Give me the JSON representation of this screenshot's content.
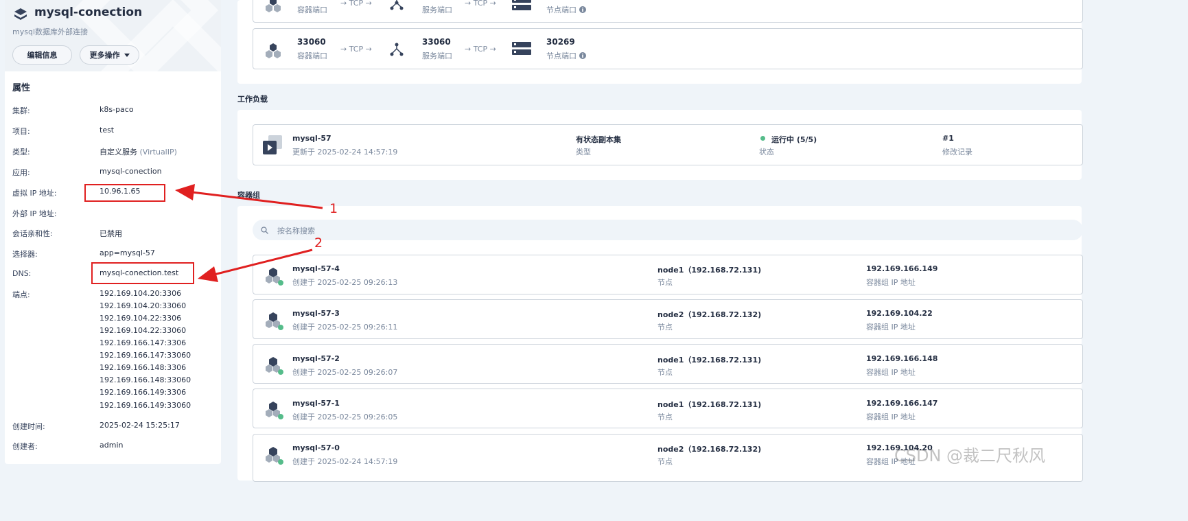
{
  "header": {
    "title": "mysql-conection",
    "description": "mysql数据库外部连接",
    "edit_button": "编辑信息",
    "more_button": "更多操作"
  },
  "properties": {
    "heading": "属性",
    "items": [
      {
        "label": "集群:",
        "value": "k8s-paco"
      },
      {
        "label": "项目:",
        "value": "test"
      },
      {
        "label": "类型:",
        "value": "自定义服务",
        "extra": "(VirtualIP)"
      },
      {
        "label": "应用:",
        "value": "mysql-conection"
      },
      {
        "label": "虚拟 IP 地址:",
        "value": "10.96.1.65"
      },
      {
        "label": "外部 IP 地址:",
        "value": ""
      },
      {
        "label": "会话亲和性:",
        "value": "已禁用"
      },
      {
        "label": "选择器:",
        "value": "app=mysql-57"
      },
      {
        "label": "DNS:",
        "value": "mysql-conection.test"
      },
      {
        "label": "端点:",
        "value": ""
      }
    ],
    "endpoints": [
      "192.169.104.20:3306",
      "192.169.104.20:33060",
      "192.169.104.22:3306",
      "192.169.104.22:33060",
      "192.169.166.147:3306",
      "192.169.166.147:33060",
      "192.169.166.148:3306",
      "192.169.166.148:33060",
      "192.169.166.149:3306",
      "192.169.166.149:33060"
    ],
    "created_label": "创建时间:",
    "created_value": "2025-02-24 15:25:17",
    "creator_label": "创建者:",
    "creator_value": "admin"
  },
  "ports": [
    {
      "container_port": "",
      "container_label": "容器端口",
      "proto": "→ TCP →",
      "service_port": "",
      "service_label": "服务端口",
      "proto2": "→ TCP →",
      "node_port": "",
      "node_label": "节点端口"
    },
    {
      "container_port": "33060",
      "container_label": "容器端口",
      "proto": "→ TCP →",
      "service_port": "33060",
      "service_label": "服务端口",
      "proto2": "→ TCP →",
      "node_port": "30269",
      "node_label": "节点端口"
    }
  ],
  "workload": {
    "section_title": "工作负载",
    "name": "mysql-57",
    "updated": "更新于 2025-02-24 14:57:19",
    "type_value": "有状态副本集",
    "type_label": "类型",
    "status_value": "运行中 (5/5)",
    "status_label": "状态",
    "revision_value": "#1",
    "revision_label": "修改记录"
  },
  "pods": {
    "section_title": "容器组",
    "search_placeholder": "按名称搜索",
    "node_label": "节点",
    "ip_label": "容器组 IP 地址",
    "items": [
      {
        "name": "mysql-57-4",
        "created": "创建于 2025-02-25 09:26:13",
        "node": "node1（192.168.72.131)",
        "ip": "192.169.166.149"
      },
      {
        "name": "mysql-57-3",
        "created": "创建于 2025-02-25 09:26:11",
        "node": "node2（192.168.72.132)",
        "ip": "192.169.104.22"
      },
      {
        "name": "mysql-57-2",
        "created": "创建于 2025-02-25 09:26:07",
        "node": "node1（192.168.72.131)",
        "ip": "192.169.166.148"
      },
      {
        "name": "mysql-57-1",
        "created": "创建于 2025-02-25 09:26:05",
        "node": "node1（192.168.72.131)",
        "ip": "192.169.166.147"
      },
      {
        "name": "mysql-57-0",
        "created": "创建于 2025-02-24 14:57:19",
        "node": "node2（192.168.72.132)",
        "ip": "192.169.104.20"
      }
    ]
  },
  "annotations": {
    "one": "1",
    "two": "2"
  },
  "watermark": "CSDN @裁二尺秋风",
  "colors": {
    "accent_red": "#e02020",
    "running_green": "#55bc8a",
    "dark_icon": "#36435c"
  }
}
